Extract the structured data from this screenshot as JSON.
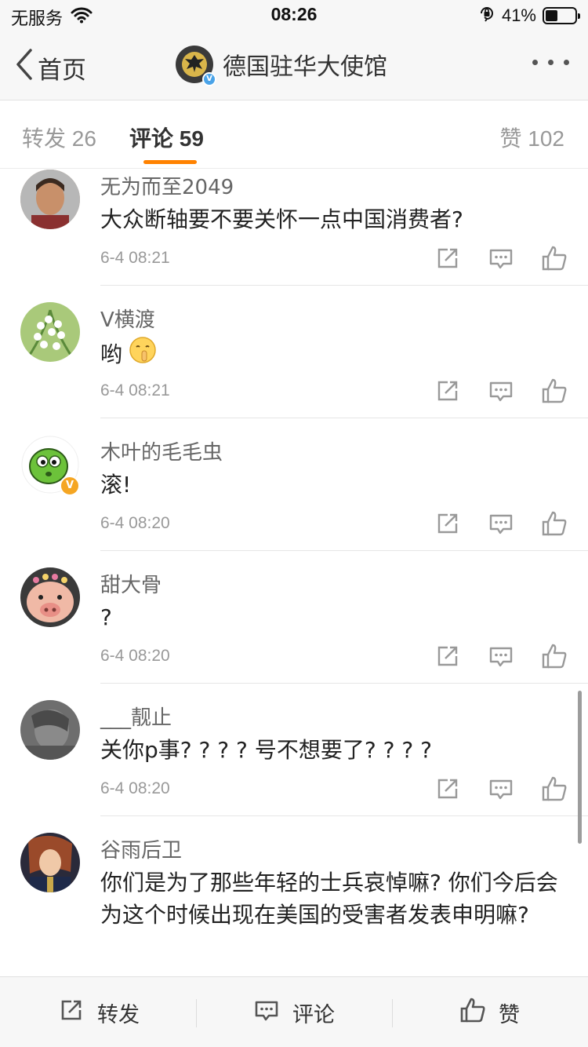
{
  "status": {
    "carrier": "无服务",
    "time": "08:26",
    "battery": "41%",
    "battery_level": 0.41
  },
  "nav": {
    "back_label": "首页",
    "title": "德国驻华大使馆"
  },
  "tabs": {
    "repost": "转发 26",
    "comment": "评论 59",
    "like": "赞 102"
  },
  "comments": [
    {
      "name": "无为而至2049",
      "text": "大众断轴要不要关怀一点中国消费者?",
      "time": "6-4 08:21"
    },
    {
      "name": "V横渡",
      "text": "哟",
      "time": "6-4 08:21"
    },
    {
      "name": "木叶的毛毛虫",
      "text": "滚!",
      "time": "6-4 08:20"
    },
    {
      "name": "甜大骨",
      "text": "?",
      "time": "6-4 08:20"
    },
    {
      "name": "___靓止",
      "text": "关你p事? ? ? ? 号不想要了? ? ? ?",
      "time": "6-4 08:20"
    },
    {
      "name": "谷雨后卫",
      "text": "你们是为了那些年轻的士兵哀悼嘛? 你们今后会为这个时候出现在美国的受害者发表申明嘛?",
      "time": ""
    }
  ],
  "bottom": {
    "repost": "转发",
    "comment": "评论",
    "like": "赞"
  },
  "colors": {
    "accent": "#ff8200",
    "verified_blue": "#4aa3e8",
    "verified_orange": "#f5a623"
  }
}
